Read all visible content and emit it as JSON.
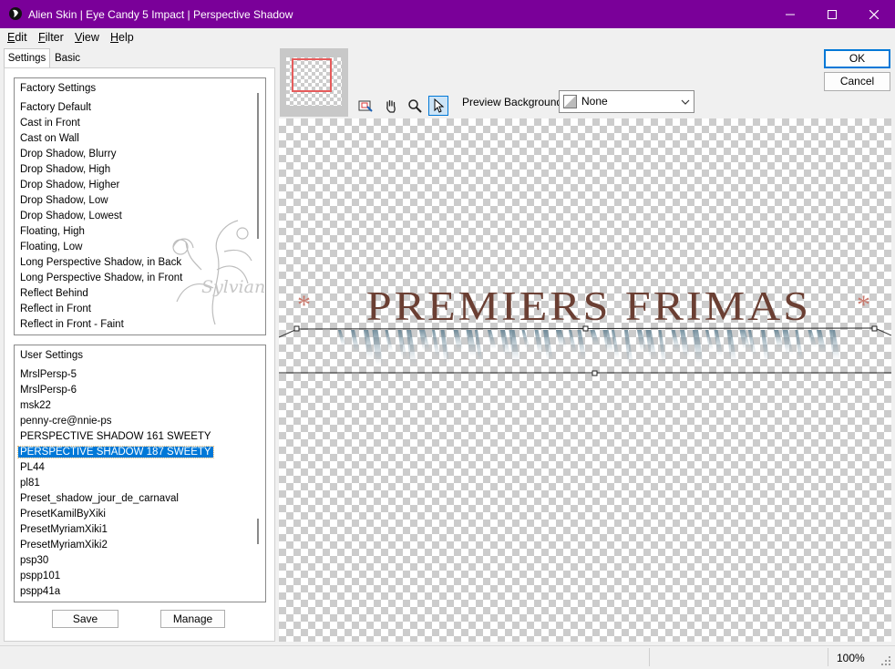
{
  "window": {
    "title": "Alien Skin | Eye Candy 5 Impact | Perspective Shadow",
    "title_bar_color": "#7a0099",
    "controls": [
      "minimize",
      "maximize",
      "close"
    ]
  },
  "menu": [
    "Edit",
    "Filter",
    "View",
    "Help"
  ],
  "tabs": [
    {
      "label": "Settings",
      "active": true
    },
    {
      "label": "Basic",
      "active": false
    }
  ],
  "factory_settings": {
    "header": "Factory Settings",
    "items": [
      "Factory Default",
      "Cast in Front",
      "Cast on Wall",
      "Drop Shadow, Blurry",
      "Drop Shadow, High",
      "Drop Shadow, Higher",
      "Drop Shadow, Low",
      "Drop Shadow, Lowest",
      "Floating, High",
      "Floating, Low",
      "Long Perspective Shadow, in Back",
      "Long Perspective Shadow, in Front",
      "Reflect Behind",
      "Reflect in Front",
      "Reflect in Front - Faint"
    ]
  },
  "user_settings": {
    "header": "User Settings",
    "items": [
      "MrslPersp-5",
      "MrslPersp-6",
      "msk22",
      "penny-cre@nnie-ps",
      "PERSPECTIVE SHADOW 161 SWEETY",
      "PERSPECTIVE SHADOW 187 SWEETY",
      "PL44",
      "pl81",
      "Preset_shadow_jour_de_carnaval",
      "PresetKamilByXiki",
      "PresetMyriamXiki1",
      "PresetMyriamXiki2",
      "psp30",
      "pspp101",
      "pspp41a"
    ],
    "selected_index": 5
  },
  "buttons": {
    "save": "Save",
    "manage": "Manage",
    "ok": "OK",
    "cancel": "Cancel"
  },
  "toolbar": {
    "tools": [
      "navigator-tool-icon",
      "hand-tool-icon",
      "zoom-tool-icon",
      "pointer-tool-icon"
    ],
    "active_tool": "pointer-tool-icon",
    "preview_background_label": "Preview Background:",
    "preview_background_value": "None"
  },
  "preview": {
    "text": "PREMIERS FRIMAS",
    "star": "*",
    "text_color": "#6b3f33",
    "watermark": "Sylviane"
  },
  "status": {
    "zoom": "100%"
  }
}
